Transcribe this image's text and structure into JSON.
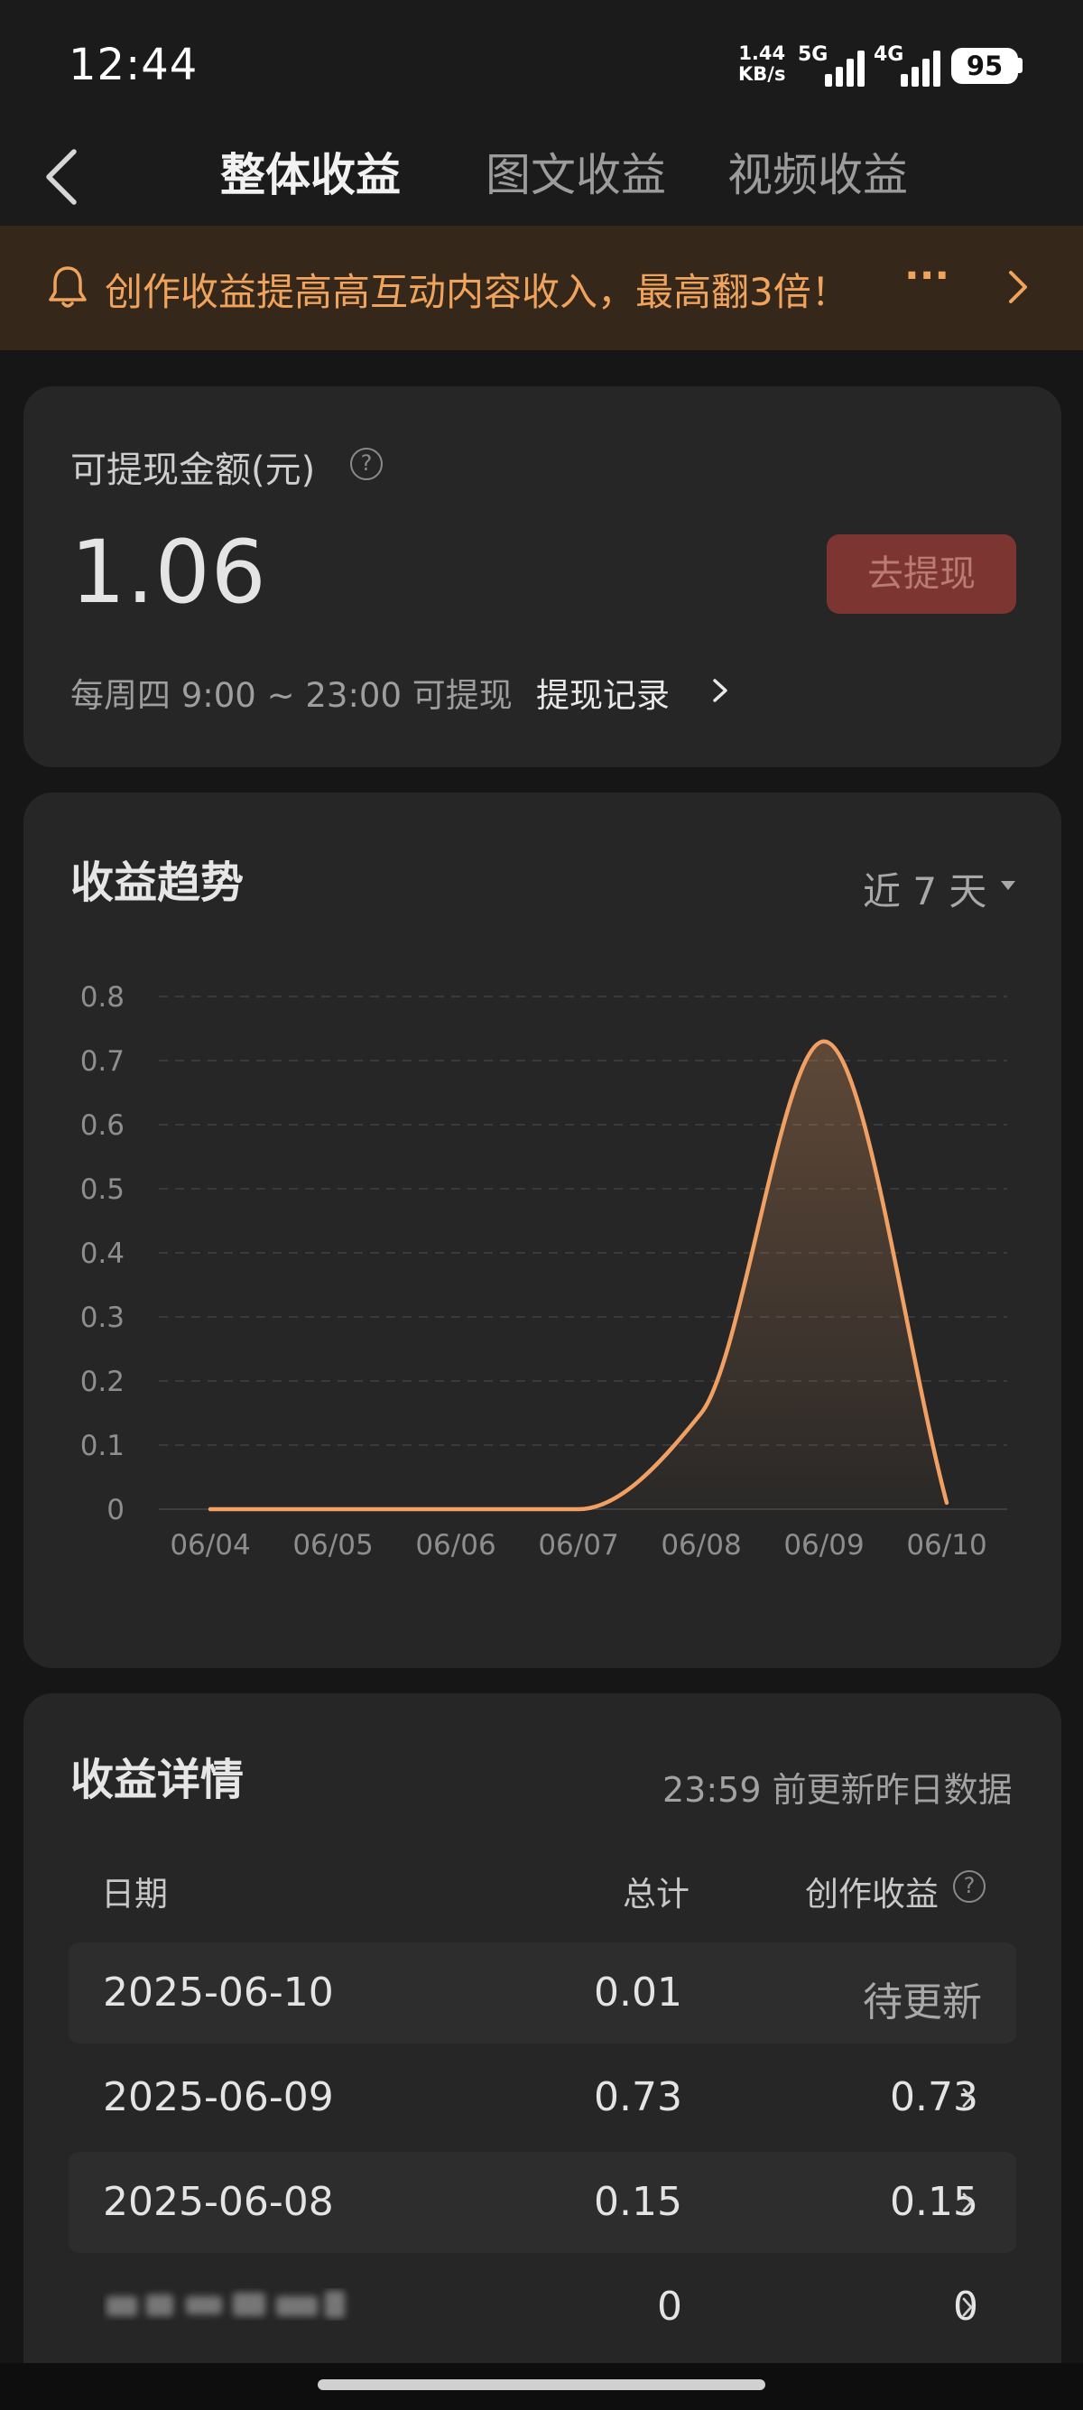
{
  "status_bar": {
    "time": "12:44",
    "net_speed_value": "1.44",
    "net_speed_unit": "KB/s",
    "signal1_label": "5G",
    "signal2_label": "4G",
    "battery": "95"
  },
  "header": {
    "tabs": [
      {
        "label": "整体收益",
        "active": true
      },
      {
        "label": "图文收益",
        "active": false
      },
      {
        "label": "视频收益",
        "active": false
      }
    ]
  },
  "banner": {
    "text": "创作收益提高高互动内容收入，最高翻3倍！",
    "more": "···",
    "icon": "bell-icon"
  },
  "withdraw": {
    "label": "可提现金额(元)",
    "help_icon": "?",
    "amount": "1.06",
    "button_label": "去提现",
    "schedule": "每周四 9:00 ~ 23:00 可提现",
    "records_link": "提现记录"
  },
  "trend": {
    "title": "收益趋势",
    "range": "近 7 天",
    "chart_data": {
      "type": "area",
      "x": [
        "06/04",
        "06/05",
        "06/06",
        "06/07",
        "06/08",
        "06/09",
        "06/10"
      ],
      "series": [
        {
          "values": [
            0,
            0,
            0,
            0,
            0.15,
            0.73,
            0.01
          ]
        }
      ],
      "ylim": [
        0,
        0.8
      ],
      "yticks": [
        "0.8",
        "0.7",
        "0.6",
        "0.5",
        "0.4",
        "0.3",
        "0.2",
        "0.1",
        "0"
      ],
      "grid": true,
      "line_color": "#f1a063"
    }
  },
  "detail": {
    "title": "收益详情",
    "update_note": "23:59 前更新昨日数据",
    "columns": {
      "date": "日期",
      "total": "总计",
      "creation": "创作收益",
      "help_icon": "?"
    },
    "rows": [
      {
        "date": "2025-06-10",
        "total": "0.01",
        "creation": "待更新"
      },
      {
        "date": "2025-06-09",
        "total": "0.73",
        "creation": "0.73"
      },
      {
        "date": "2025-06-08",
        "total": "0.15",
        "creation": "0.15"
      },
      {
        "date": "",
        "total": "0",
        "creation": "0"
      }
    ]
  },
  "colors": {
    "accent_orange": "#f0a35c",
    "withdraw_button_bg": "#7c3530",
    "card_bg": "#262626",
    "page_bg": "#161616"
  }
}
